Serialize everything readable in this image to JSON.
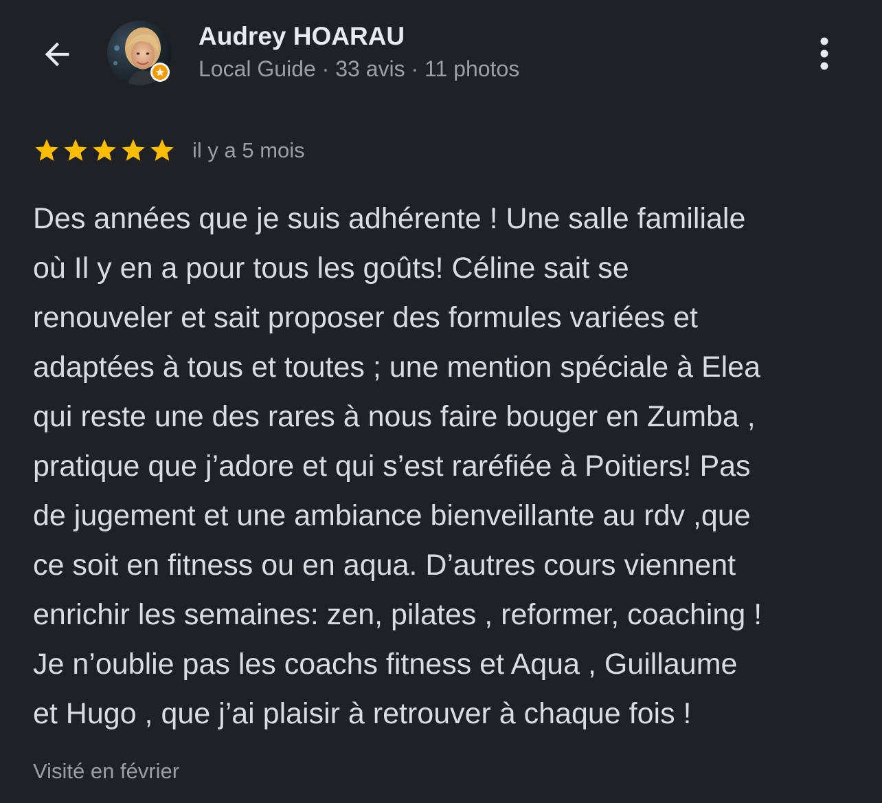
{
  "header": {
    "back_icon": "arrow-back-icon",
    "user_name": "Audrey HOARAU",
    "user_meta": "Local Guide · 33 avis · 11 photos",
    "badge_icon": "local-guide-badge-icon",
    "more_icon": "more-vert-icon"
  },
  "review": {
    "rating": 5,
    "rating_max": 5,
    "star_color": "#fbbc04",
    "date": "il y a 5 mois",
    "lines": [
      "Des années que je suis adhérente ! Une salle familiale",
      "où Il y en a pour tous les goûts! Céline sait se",
      "renouveler et sait proposer des formules variées et",
      "adaptées à tous et toutes ; une mention spéciale à Elea",
      "qui reste une des rares à nous faire bouger en Zumba ,",
      "pratique que j’adore et qui s’est raréfiée à Poitiers! Pas",
      "de jugement et une ambiance bienveillante au rdv ,que",
      "ce soit en fitness ou en aqua. D’autres cours viennent",
      "enrichir les semaines: zen, pilates , reformer, coaching !",
      "Je n’oublie pas les coachs fitness et Aqua , Guillaume",
      "et Hugo , que j’ai plaisir à retrouver à chaque fois !"
    ],
    "visited": "Visité en février"
  },
  "colors": {
    "background": "#202124",
    "text_primary": "#e8eaed",
    "text_secondary": "#9aa0a6",
    "star": "#fbbc04",
    "badge": "#f29900"
  }
}
